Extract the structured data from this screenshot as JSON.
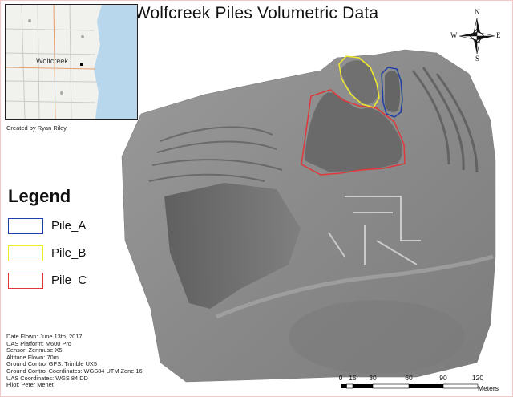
{
  "title": "Wolfcreek Piles Volumetric Data",
  "inset": {
    "place_label": "Wolfcreek"
  },
  "credit": "Created by Ryan Riley",
  "legend": {
    "title": "Legend",
    "items": [
      {
        "label": "Pile_A",
        "color": "#1f3fa8"
      },
      {
        "label": "Pile_B",
        "color": "#f2ea2c"
      },
      {
        "label": "Pile_C",
        "color": "#e0383a"
      }
    ]
  },
  "metadata": [
    "Date Flown: June 13th, 2017",
    "UAS Platform: M600 Pro",
    "Sensor: Zenmuse X5",
    "Altitude Flown: 70m",
    "Ground Control GPS: Trimble UX5",
    "Ground Control Coordinates: WGS84 UTM Zone 16",
    "UAS Coordinates: WGS 84 DD",
    "Pilot: Peter Menet"
  ],
  "north_arrow": {
    "n": "N",
    "s": "S",
    "e": "E",
    "w": "W"
  },
  "scale_bar": {
    "ticks": [
      "0",
      "15",
      "30",
      "60",
      "90",
      "120"
    ],
    "units": "Meters"
  },
  "colors": {
    "hillshade": "#8c8c8c",
    "frame": "#f2c9c9"
  }
}
